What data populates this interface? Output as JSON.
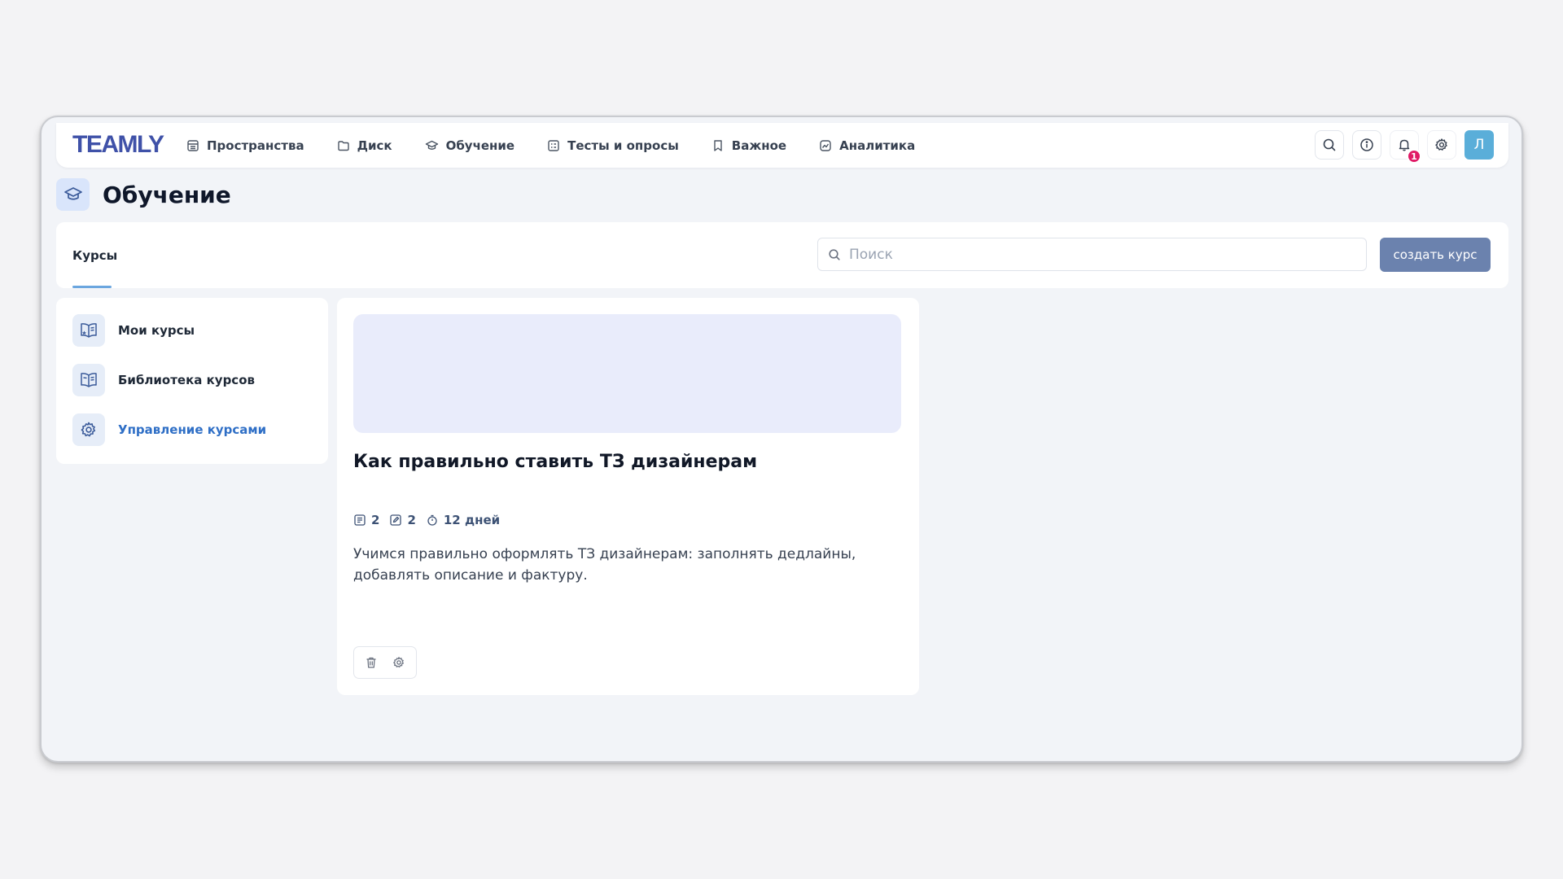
{
  "app": {
    "logo_text": "TEAMLY"
  },
  "nav": {
    "items": [
      {
        "label": "Пространства",
        "icon": "spaces-icon"
      },
      {
        "label": "Диск",
        "icon": "folder-icon"
      },
      {
        "label": "Обучение",
        "icon": "graduation-cap-icon"
      },
      {
        "label": "Тесты и опросы",
        "icon": "checklist-icon"
      },
      {
        "label": "Важное",
        "icon": "bookmark-icon"
      },
      {
        "label": "Аналитика",
        "icon": "chart-icon"
      }
    ],
    "notifications_count": "1",
    "avatar_letter": "Л"
  },
  "page": {
    "title": "Обучение"
  },
  "tabs": {
    "active": "Курсы"
  },
  "search": {
    "placeholder": "Поиск",
    "value": ""
  },
  "toolbar": {
    "create_label": "создать курс"
  },
  "sidebar": {
    "items": [
      {
        "label": "Мои курсы",
        "icon": "my-courses-icon",
        "active": false
      },
      {
        "label": "Библиотека курсов",
        "icon": "library-icon",
        "active": false
      },
      {
        "label": "Управление курсами",
        "icon": "gear-icon",
        "active": true
      }
    ]
  },
  "course": {
    "title": "Как правильно ставить ТЗ дизайнерам",
    "lessons_count": "2",
    "tasks_count": "2",
    "duration": "12 дней",
    "description": "Учимся правильно оформлять ТЗ дизайнерам: заполнять дедлайны, добавлять описание и фактуру."
  },
  "colors": {
    "accent": "#6b82ae",
    "active_link": "#2f6fc6",
    "badge": "#e01a66",
    "avatar": "#5aaed9"
  }
}
